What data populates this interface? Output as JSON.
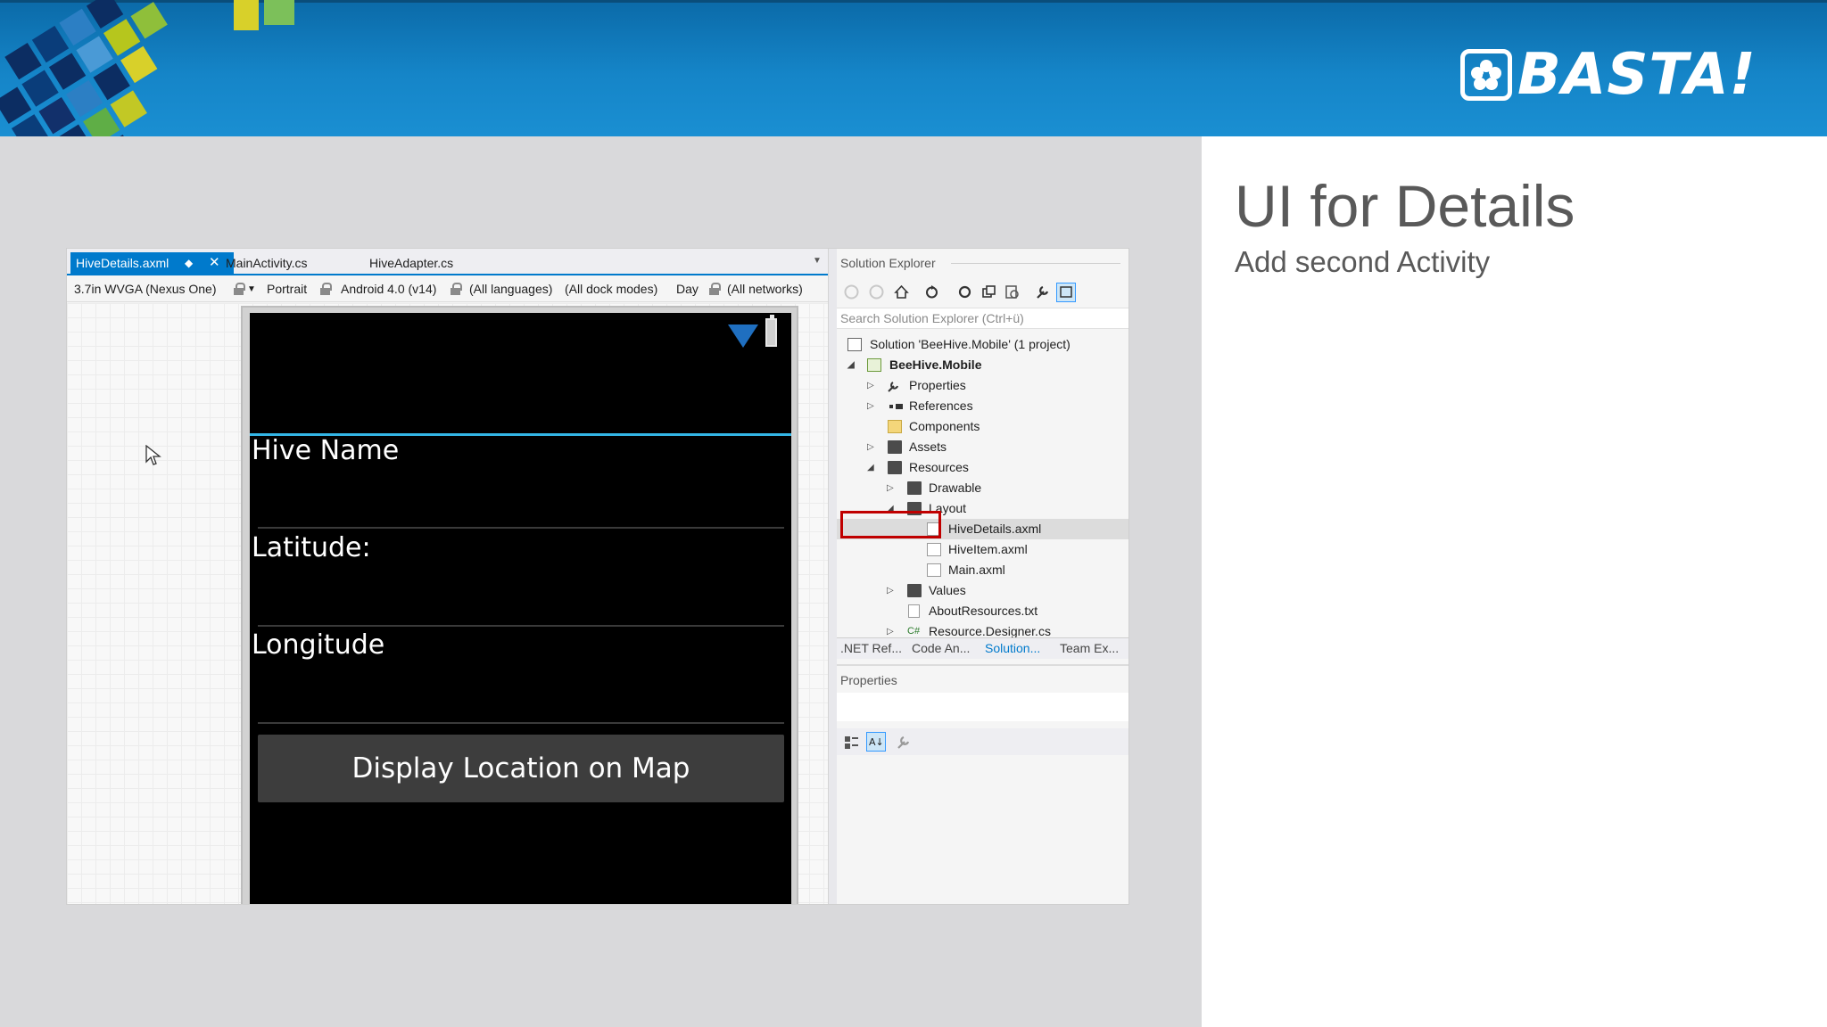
{
  "colors": {
    "header_blue": "#1585c8",
    "grey_bg": "#d9d9db",
    "title_text": "#595959",
    "accent_tab": "#007acc",
    "highlight_red": "#c00000",
    "holo_blue": "#33b5e5"
  },
  "header": {
    "logo_text": "BASTA!",
    "logo_icon": "flower-icon"
  },
  "slide": {
    "title": "UI for Details",
    "subtitle": "Add second Activity"
  },
  "ide": {
    "tabs": [
      {
        "label": "HiveDetails.axml",
        "active": true
      },
      {
        "label": "MainActivity.cs",
        "active": false
      },
      {
        "label": "HiveAdapter.cs",
        "active": false
      }
    ],
    "config_bar": {
      "device": "3.7in WVGA (Nexus One)",
      "orientation": "Portrait",
      "api": "Android 4.0 (v14)",
      "languages": "(All languages)",
      "dock": "(All dock modes)",
      "theme": "Day",
      "networks": "(All networks)"
    },
    "phone": {
      "label_hive_name": "Hive Name",
      "label_latitude": "Latitude:",
      "label_longitude": "Longitude",
      "button": "Display Location on Map"
    },
    "solution_explorer": {
      "title": "Solution Explorer",
      "search_placeholder": "Search Solution Explorer (Ctrl+ü)",
      "tree": [
        {
          "label": "Solution 'BeeHive.Mobile' (1 project)"
        },
        {
          "label": "BeeHive.Mobile"
        },
        {
          "label": "Properties"
        },
        {
          "label": "References"
        },
        {
          "label": "Components"
        },
        {
          "label": "Assets"
        },
        {
          "label": "Resources"
        },
        {
          "label": "Drawable"
        },
        {
          "label": "Layout"
        },
        {
          "label": "HiveDetails.axml"
        },
        {
          "label": "HiveItem.axml"
        },
        {
          "label": "Main.axml"
        },
        {
          "label": "Values"
        },
        {
          "label": "AboutResources.txt"
        },
        {
          "label": "Resource.Designer.cs"
        }
      ],
      "bottom_tabs": [
        ".NET Ref...",
        "Code An...",
        "Solution...",
        "Team Ex..."
      ]
    },
    "properties": {
      "title": "Properties"
    }
  }
}
